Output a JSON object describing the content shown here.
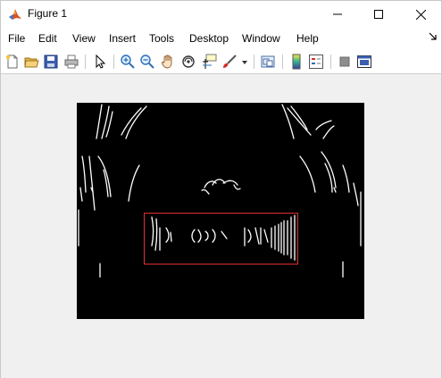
{
  "window": {
    "title": "Figure 1",
    "app_icon": "matlab-icon",
    "controls": [
      "minimize-icon",
      "maximize-icon",
      "close-icon"
    ]
  },
  "menubar": {
    "items": [
      "File",
      "Edit",
      "View",
      "Insert",
      "Tools",
      "Desktop",
      "Window",
      "Help"
    ],
    "dock_icon": "dock-arrow-icon"
  },
  "toolbar": {
    "buttons": [
      "new-figure-icon",
      "open-file-icon",
      "save-icon",
      "print-icon",
      "edit-plot-arrow-icon",
      "zoom-in-icon",
      "zoom-out-icon",
      "pan-hand-icon",
      "rotate-3d-icon",
      "data-cursor-icon",
      "brush-icon",
      "brush-dropdown-icon",
      "link-plot-icon",
      "insert-colorbar-icon",
      "insert-legend-icon",
      "hide-plot-tools-icon",
      "show-plot-tools-icon"
    ]
  },
  "figure": {
    "image_description_colors": {
      "background": "#000000",
      "edges": "#ffffff",
      "box": "#e03030"
    }
  }
}
